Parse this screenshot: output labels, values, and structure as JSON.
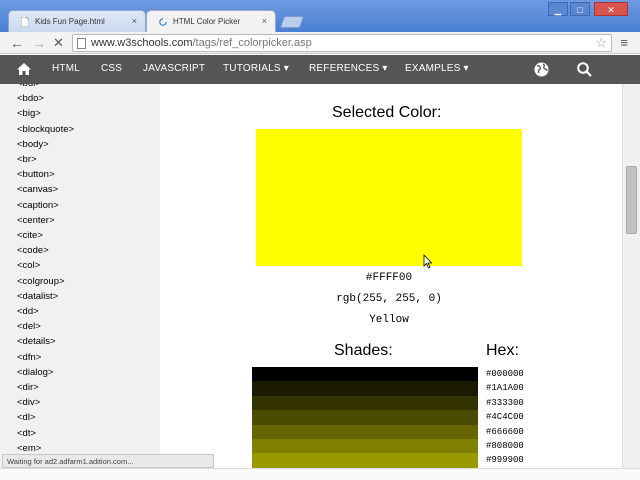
{
  "browser": {
    "tabs": [
      {
        "title": "Kids Fun Page.html",
        "active": false
      },
      {
        "title": "HTML Color Picker",
        "active": true
      }
    ],
    "close_glyph": "×",
    "url_domain": "www.w3schools.com",
    "url_path": "/tags/ref_colorpicker.asp",
    "status": "Waiting for ad2.adfarm1.adition.com..."
  },
  "site_nav": {
    "items": [
      "HTML",
      "CSS",
      "JAVASCRIPT",
      "TUTORIALS ▾",
      "REFERENCES ▾",
      "EXAMPLES ▾"
    ],
    "bg_color": "#555555"
  },
  "sidebar": {
    "tags": [
      "<bdi>",
      "<bdo>",
      "<big>",
      "<blockquote>",
      "<body>",
      "<br>",
      "<button>",
      "<canvas>",
      "<caption>",
      "<center>",
      "<cite>",
      "<code>",
      "<col>",
      "<colgroup>",
      "<datalist>",
      "<dd>",
      "<del>",
      "<details>",
      "<dfn>",
      "<dialog>",
      "<dir>",
      "<div>",
      "<dl>",
      "<dt>",
      "<em>"
    ]
  },
  "main": {
    "selected_heading": "Selected Color:",
    "selected_color": "#FFFF00",
    "hex": "#FFFF00",
    "rgb": "rgb(255, 255, 0)",
    "name": "Yellow",
    "shades_heading": "Shades:",
    "hex_heading": "Hex:",
    "shades": [
      {
        "hex": "#000000"
      },
      {
        "hex": "#1A1A00"
      },
      {
        "hex": "#333300"
      },
      {
        "hex": "#4C4C00"
      },
      {
        "hex": "#666600"
      },
      {
        "hex": "#808000"
      },
      {
        "hex": "#999900"
      }
    ]
  }
}
